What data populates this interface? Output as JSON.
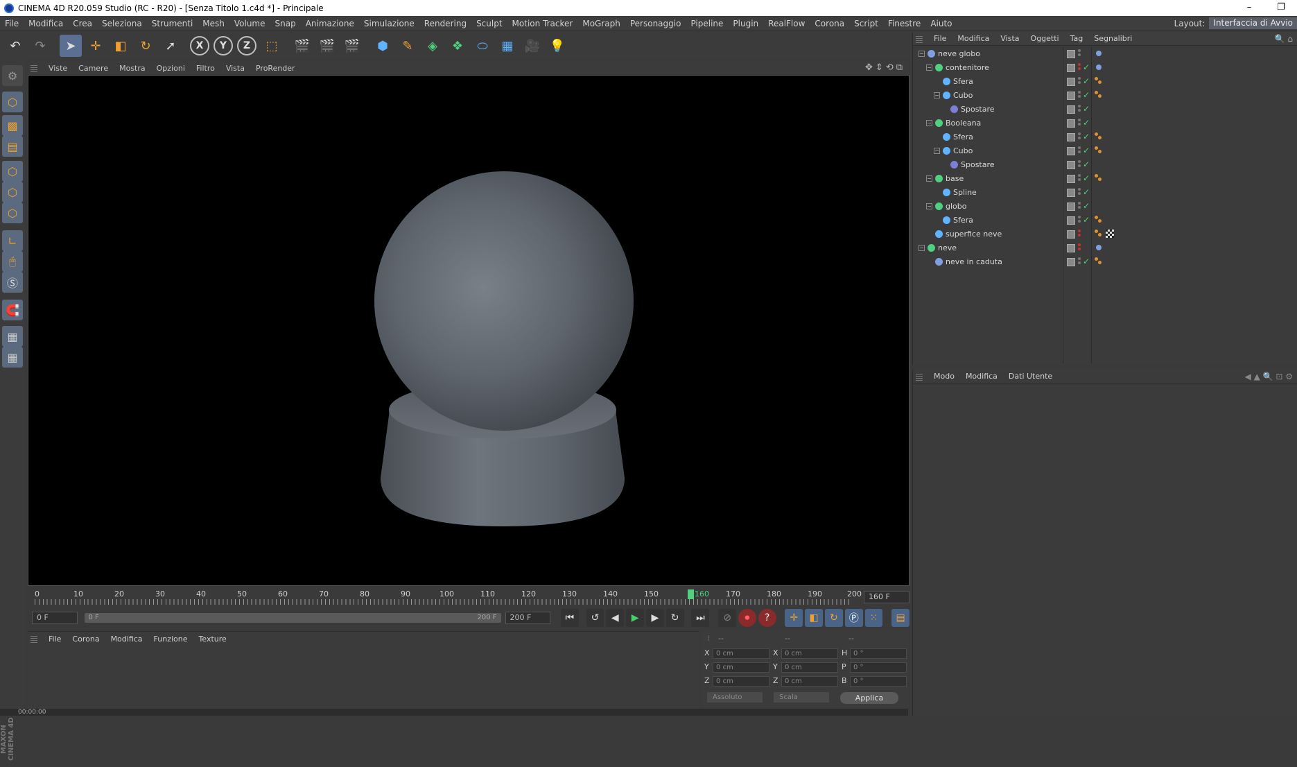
{
  "window": {
    "title": "CINEMA 4D R20.059 Studio (RC - R20) - [Senza Titolo 1.c4d *] - Principale",
    "minimize": "–",
    "restore": "❐"
  },
  "menu": [
    "File",
    "Modifica",
    "Crea",
    "Seleziona",
    "Strumenti",
    "Mesh",
    "Volume",
    "Snap",
    "Animazione",
    "Simulazione",
    "Rendering",
    "Sculpt",
    "Motion Tracker",
    "MoGraph",
    "Personaggio",
    "Pipeline",
    "Plugin",
    "RealFlow",
    "Corona",
    "Script",
    "Finestre",
    "Aiuto"
  ],
  "layout": {
    "label": "Layout:",
    "value": "Interfaccia di Avvio"
  },
  "viewport_menu": [
    "Viste",
    "Camere",
    "Mostra",
    "Opzioni",
    "Filtro",
    "Vista",
    "ProRender"
  ],
  "timeline": {
    "ticks": [
      "0",
      "10",
      "20",
      "30",
      "40",
      "50",
      "60",
      "70",
      "80",
      "90",
      "100",
      "110",
      "120",
      "130",
      "140",
      "150",
      "160",
      "170",
      "180",
      "190",
      "200"
    ],
    "current_frame": 160,
    "current_frame_label": "160 F",
    "start_field": "0 F",
    "range_start": "0 F",
    "range_end": "200 F",
    "end_field": "200 F"
  },
  "material_menu": [
    "File",
    "Corona",
    "Modifica",
    "Funzione",
    "Texture"
  ],
  "coords": {
    "headers": [
      "--",
      "--",
      "--"
    ],
    "rows": [
      {
        "a": "X",
        "av": "0 cm",
        "b": "X",
        "bv": "0 cm",
        "c": "H",
        "cv": "0 °"
      },
      {
        "a": "Y",
        "av": "0 cm",
        "b": "Y",
        "bv": "0 cm",
        "c": "P",
        "cv": "0 °"
      },
      {
        "a": "Z",
        "av": "0 cm",
        "b": "Z",
        "bv": "0 cm",
        "c": "B",
        "cv": "0 °"
      }
    ],
    "mode1": "Assoluto",
    "mode2": "Scala",
    "apply": "Applica"
  },
  "status": "00:00:00",
  "maxon_label": "MAXON CINEMA 4D",
  "objects_menu": [
    "File",
    "Modifica",
    "Vista",
    "Oggetti",
    "Tag",
    "Segnalibri"
  ],
  "objects": [
    {
      "name": "neve globo",
      "depth": 0,
      "icon": "null-icon",
      "tags": [
        "blue"
      ]
    },
    {
      "name": "contenitore",
      "depth": 1,
      "icon": "boole-icon",
      "tags": [
        "blue"
      ]
    },
    {
      "name": "Sfera",
      "depth": 2,
      "icon": "sphere-icon",
      "tags": [
        "phong"
      ]
    },
    {
      "name": "Cubo",
      "depth": 2,
      "icon": "cube-icon",
      "tags": [
        "phong"
      ]
    },
    {
      "name": "Spostare",
      "depth": 3,
      "icon": "displacer-icon",
      "tags": []
    },
    {
      "name": "Booleana",
      "depth": 1,
      "icon": "boole-icon",
      "tags": []
    },
    {
      "name": "Sfera",
      "depth": 2,
      "icon": "sphere-icon",
      "tags": [
        "phong"
      ]
    },
    {
      "name": "Cubo",
      "depth": 2,
      "icon": "cube-icon",
      "tags": [
        "phong"
      ]
    },
    {
      "name": "Spostare",
      "depth": 3,
      "icon": "displacer-icon",
      "tags": []
    },
    {
      "name": "base",
      "depth": 1,
      "icon": "lathe-icon",
      "tags": [
        "phong"
      ]
    },
    {
      "name": "Spline",
      "depth": 2,
      "icon": "spline-icon",
      "tags": []
    },
    {
      "name": "globo",
      "depth": 1,
      "icon": "boole-icon",
      "tags": []
    },
    {
      "name": "Sfera",
      "depth": 2,
      "icon": "sphere-icon",
      "tags": [
        "phong"
      ]
    },
    {
      "name": "superfice neve",
      "depth": 1,
      "icon": "surface-icon",
      "tags": [
        "phong",
        "checker"
      ]
    },
    {
      "name": "neve",
      "depth": 0,
      "icon": "emitter-icon",
      "tags": [
        "blue"
      ]
    },
    {
      "name": "neve in caduta",
      "depth": 1,
      "icon": "particle-icon",
      "tags": [
        "phong"
      ]
    }
  ],
  "attributes_menu": [
    "Modo",
    "Modifica",
    "Dati Utente"
  ],
  "colors": {
    "accent": "#5b6f92",
    "playhead": "#4fd17f",
    "object_green": "#4fd17f"
  }
}
